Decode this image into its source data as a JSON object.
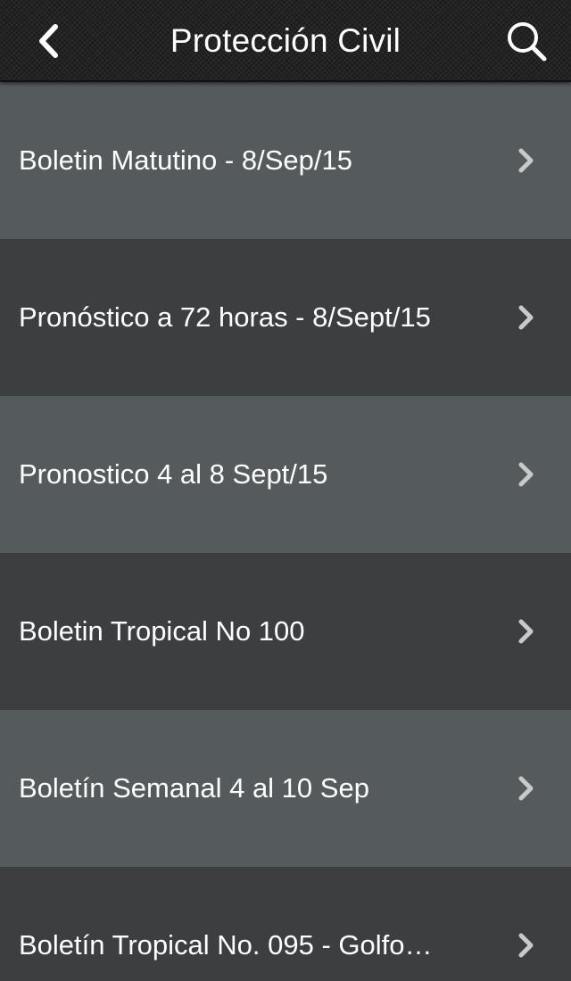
{
  "header": {
    "title": "Protección Civil",
    "back_icon": "chevron-left-icon",
    "search_icon": "search-icon"
  },
  "items": [
    {
      "label": "Boletin Matutino - 8/Sep/15"
    },
    {
      "label": "Pronóstico a 72 horas - 8/Sept/15"
    },
    {
      "label": "Pronostico 4 al 8 Sept/15"
    },
    {
      "label": "Boletin Tropical No 100"
    },
    {
      "label": "Boletín Semanal 4 al 10 Sep"
    },
    {
      "label": "Boletín Tropical No. 095 - Golfo…"
    }
  ],
  "colors": {
    "row_light": "#555a5d",
    "row_dark": "#3d3e40",
    "chevron": "#c8c9ca",
    "text": "#ffffff"
  }
}
